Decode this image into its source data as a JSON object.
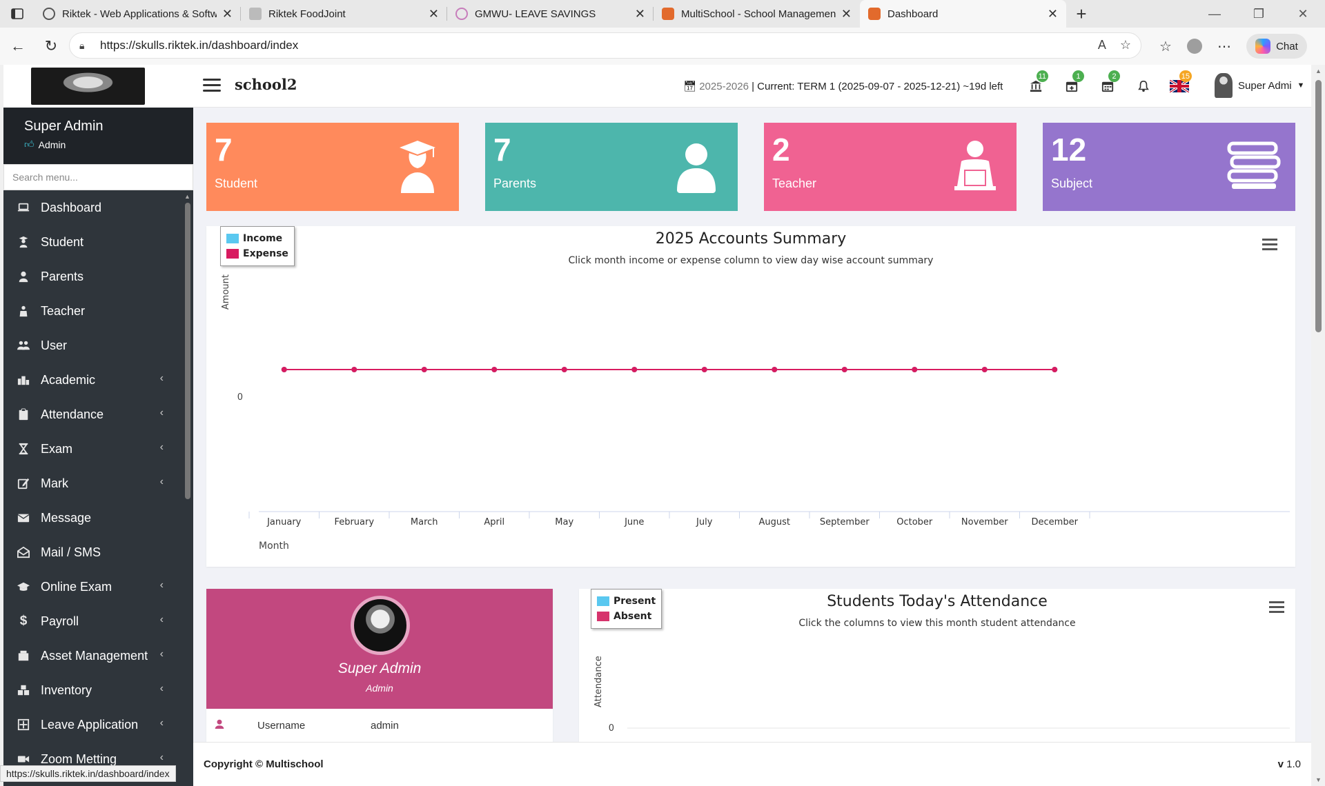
{
  "browser": {
    "tabs": [
      {
        "title": "Riktek - Web Applications & Softw",
        "color": "#4a7bd1"
      },
      {
        "title": "Riktek FoodJoint",
        "color": "#999999"
      },
      {
        "title": "GMWU- LEAVE SAVINGS",
        "color": "#c77dbb"
      },
      {
        "title": "MultiSchool - School Managemen",
        "color": "#e26a2c"
      },
      {
        "title": "Dashboard",
        "color": "#e26a2c"
      }
    ],
    "url": "https://skulls.riktek.in/dashboard/index",
    "chat_label": "Chat",
    "status_url": "https://skulls.riktek.in/dashboard/index"
  },
  "header": {
    "school_name": "school2",
    "session_year": "2025-2026",
    "session_text": " | Current: TERM 1 (2025-09-07 - 2025-12-21) ~19d left",
    "badges": {
      "bank": "11",
      "calendar_add": "1",
      "calendar": "2",
      "language": "15"
    },
    "user_name": "Super Admi"
  },
  "sidebar": {
    "user_name": "Super Admin",
    "user_role": "Admin",
    "search_placeholder": "Search menu...",
    "items": [
      {
        "label": "Dashboard",
        "icon": "laptop-icon",
        "has_submenu": false
      },
      {
        "label": "Student",
        "icon": "student-icon",
        "has_submenu": false
      },
      {
        "label": "Parents",
        "icon": "user-icon",
        "has_submenu": false
      },
      {
        "label": "Teacher",
        "icon": "teacher-icon",
        "has_submenu": false
      },
      {
        "label": "User",
        "icon": "users-icon",
        "has_submenu": false
      },
      {
        "label": "Academic",
        "icon": "academic-icon",
        "has_submenu": true
      },
      {
        "label": "Attendance",
        "icon": "clipboard-icon",
        "has_submenu": true
      },
      {
        "label": "Exam",
        "icon": "hourglass-icon",
        "has_submenu": true
      },
      {
        "label": "Mark",
        "icon": "edit-icon",
        "has_submenu": true
      },
      {
        "label": "Message",
        "icon": "envelope-icon",
        "has_submenu": false
      },
      {
        "label": "Mail / SMS",
        "icon": "envelope-open-icon",
        "has_submenu": false
      },
      {
        "label": "Online Exam",
        "icon": "graduation-cap-icon",
        "has_submenu": true
      },
      {
        "label": "Payroll",
        "icon": "dollar-icon",
        "has_submenu": true
      },
      {
        "label": "Asset Management",
        "icon": "building-icon",
        "has_submenu": true
      },
      {
        "label": "Inventory",
        "icon": "inventory-icon",
        "has_submenu": true
      },
      {
        "label": "Leave Application",
        "icon": "leave-icon",
        "has_submenu": true
      },
      {
        "label": "Zoom Metting",
        "icon": "video-icon",
        "has_submenu": true
      }
    ]
  },
  "stats": [
    {
      "value": "7",
      "label": "Student",
      "color": "#ff8a5c",
      "icon": "student-cap-icon"
    },
    {
      "value": "7",
      "label": "Parents",
      "color": "#4db6ac",
      "icon": "user-icon"
    },
    {
      "value": "2",
      "label": "Teacher",
      "color": "#f06292",
      "icon": "teacher-icon"
    },
    {
      "value": "12",
      "label": "Subject",
      "color": "#9575cd",
      "icon": "books-icon"
    }
  ],
  "accounts_chart": {
    "title": "2025 Accounts Summary",
    "subtitle": "Click month income or expense column to view day wise account summary",
    "legend": [
      {
        "name": "Income",
        "color": "#5ac8f0"
      },
      {
        "name": "Expense",
        "color": "#d81b60"
      }
    ]
  },
  "attendance_chart": {
    "title": "Students Today's Attendance",
    "subtitle": "Click the columns to view this month student attendance",
    "legend": [
      {
        "name": "Present",
        "color": "#5ac8f0"
      },
      {
        "name": "Absent",
        "color": "#d6336c"
      }
    ]
  },
  "chart_data": [
    {
      "type": "line",
      "title": "2025 Accounts Summary",
      "subtitle": "Click month income or expense column to view day wise account summary",
      "xlabel": "Month",
      "ylabel": "Amount",
      "categories": [
        "January",
        "February",
        "March",
        "April",
        "May",
        "June",
        "July",
        "August",
        "September",
        "October",
        "November",
        "December"
      ],
      "series": [
        {
          "name": "Income",
          "values": [
            0,
            0,
            0,
            0,
            0,
            0,
            0,
            0,
            0,
            0,
            0,
            0
          ],
          "color": "#5ac8f0"
        },
        {
          "name": "Expense",
          "values": [
            0,
            0,
            0,
            0,
            0,
            0,
            0,
            0,
            0,
            0,
            0,
            0
          ],
          "color": "#d81b60"
        }
      ],
      "y_ticks": [
        "0"
      ],
      "legend_position": "top-left"
    },
    {
      "type": "bar",
      "title": "Students Today's Attendance",
      "subtitle": "Click the columns to view this month student attendance",
      "ylabel": "Attendance",
      "series": [
        {
          "name": "Present",
          "values": [],
          "color": "#5ac8f0"
        },
        {
          "name": "Absent",
          "values": [],
          "color": "#d6336c"
        }
      ],
      "y_ticks": [
        "0"
      ],
      "legend_position": "top-left"
    }
  ],
  "profile": {
    "name": "Super Admin",
    "role": "Admin",
    "rows": [
      {
        "key": "Username",
        "value": "admin"
      }
    ]
  },
  "footer": {
    "copyright": "Copyright © Multischool",
    "version_prefix": "v",
    "version": " 1.0"
  }
}
